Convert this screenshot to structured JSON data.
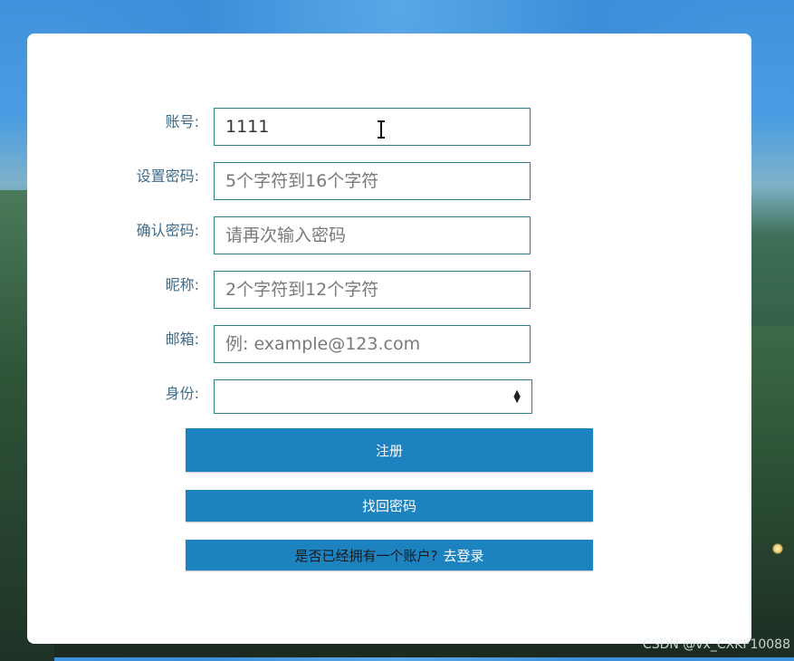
{
  "form": {
    "account": {
      "label": "账号:",
      "value": "1111"
    },
    "password": {
      "label": "设置密码:",
      "placeholder": "5个字符到16个字符"
    },
    "confirm_password": {
      "label": "确认密码:",
      "placeholder": "请再次输入密码"
    },
    "nickname": {
      "label": "昵称:",
      "placeholder": "2个字符到12个字符"
    },
    "email": {
      "label": "邮箱:",
      "placeholder": "例: example@123.com"
    },
    "identity": {
      "label": "身份:",
      "selected": ""
    }
  },
  "buttons": {
    "register": "注册",
    "recover_password": "找回密码",
    "login_prompt": "是否已经拥有一个账户?",
    "login_link": "去登录"
  },
  "watermark": "CSDN @vx_CXKF10088",
  "colors": {
    "button": "#1c82c0",
    "field_border": "#2e7f8a",
    "label": "#3f6b88"
  }
}
